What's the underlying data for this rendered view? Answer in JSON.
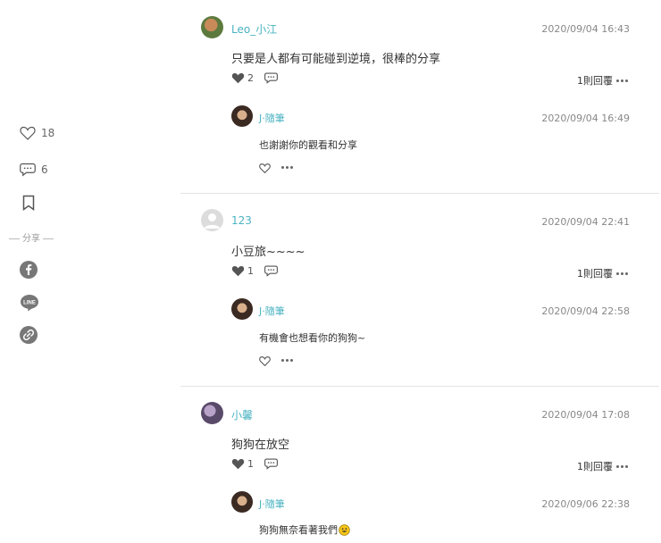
{
  "sidebar": {
    "like_count": "18",
    "comment_count": "6",
    "share_label": "分享"
  },
  "comments": [
    {
      "name": "Leo_小江",
      "time": "2020/09/04 16:43",
      "text": "只要是人都有可能碰到逆境，很棒的分享",
      "likes": "2",
      "reply_label": "1則回覆",
      "reply": {
        "name": "J·隨筆",
        "time": "2020/09/04 16:49",
        "text": "也謝謝你的觀看和分享"
      }
    },
    {
      "name": "123",
      "time": "2020/09/04 22:41",
      "text": "小豆旅~~~~",
      "likes": "1",
      "reply_label": "1則回覆",
      "reply": {
        "name": "J·隨筆",
        "time": "2020/09/04 22:58",
        "text": "有機會也想看你的狗狗~"
      }
    },
    {
      "name": "小馨",
      "time": "2020/09/04 17:08",
      "text": "狗狗在放空",
      "likes": "1",
      "reply_label": "1則回覆",
      "reply": {
        "name": "J·隨筆",
        "time": "2020/09/06 22:38",
        "text": "狗狗無奈看著我們"
      }
    }
  ]
}
